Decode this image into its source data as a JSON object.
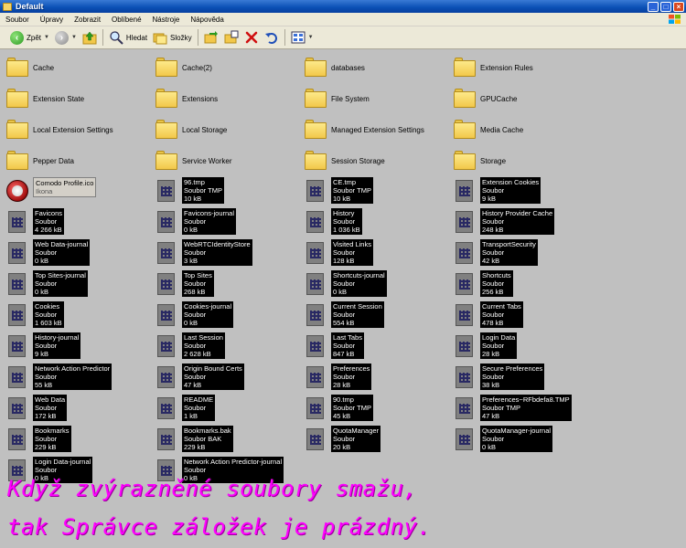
{
  "window": {
    "title": "Default"
  },
  "menu": [
    "Soubor",
    "Úpravy",
    "Zobrazit",
    "Oblíbené",
    "Nástroje",
    "Nápověda"
  ],
  "toolbar": {
    "back_label": "Zpět",
    "search_label": "Hledat",
    "folders_label": "Složky"
  },
  "folders": [
    "Cache",
    "Cache(2)",
    "databases",
    "Extension Rules",
    "Extension State",
    "Extensions",
    "File System",
    "GPUCache",
    "Local Extension Settings",
    "Local Storage",
    "Managed Extension Settings",
    "Media Cache",
    "Pepper Data",
    "Service Worker",
    "Session Storage",
    "Storage"
  ],
  "comodo": {
    "name": "Comodo Profile.ico",
    "type": "Ikona"
  },
  "files": [
    {
      "name": "96.tmp",
      "type": "Soubor TMP",
      "size": "10 kB"
    },
    {
      "name": "CE.tmp",
      "type": "Soubor TMP",
      "size": "10 kB"
    },
    {
      "name": "Extension Cookies",
      "type": "Soubor",
      "size": "9 kB"
    },
    {
      "name": "Favicons",
      "type": "Soubor",
      "size": "4 266 kB"
    },
    {
      "name": "Favicons-journal",
      "type": "Soubor",
      "size": "0 kB"
    },
    {
      "name": "History",
      "type": "Soubor",
      "size": "1 036 kB"
    },
    {
      "name": "History Provider Cache",
      "type": "Soubor",
      "size": "248 kB"
    },
    {
      "name": "Web Data-journal",
      "type": "Soubor",
      "size": "0 kB"
    },
    {
      "name": "WebRTCIdentityStore",
      "type": "Soubor",
      "size": "3 kB"
    },
    {
      "name": "Visited Links",
      "type": "Soubor",
      "size": "128 kB"
    },
    {
      "name": "TransportSecurity",
      "type": "Soubor",
      "size": "42 kB"
    },
    {
      "name": "Top Sites-journal",
      "type": "Soubor",
      "size": "0 kB"
    },
    {
      "name": "Top Sites",
      "type": "Soubor",
      "size": "268 kB"
    },
    {
      "name": "Shortcuts-journal",
      "type": "Soubor",
      "size": "0 kB"
    },
    {
      "name": "Shortcuts",
      "type": "Soubor",
      "size": "256 kB"
    },
    {
      "name": "Cookies",
      "type": "Soubor",
      "size": "1 603 kB"
    },
    {
      "name": "Cookies-journal",
      "type": "Soubor",
      "size": "0 kB"
    },
    {
      "name": "Current Session",
      "type": "Soubor",
      "size": "554 kB"
    },
    {
      "name": "Current Tabs",
      "type": "Soubor",
      "size": "478 kB"
    },
    {
      "name": "History-journal",
      "type": "Soubor",
      "size": "9 kB"
    },
    {
      "name": "Last Session",
      "type": "Soubor",
      "size": "2 628 kB"
    },
    {
      "name": "Last Tabs",
      "type": "Soubor",
      "size": "847 kB"
    },
    {
      "name": "Login Data",
      "type": "Soubor",
      "size": "28 kB"
    },
    {
      "name": "Network Action Predictor",
      "type": "Soubor",
      "size": "55 kB"
    },
    {
      "name": "Origin Bound Certs",
      "type": "Soubor",
      "size": "47 kB"
    },
    {
      "name": "Preferences",
      "type": "Soubor",
      "size": "28 kB"
    },
    {
      "name": "Secure Preferences",
      "type": "Soubor",
      "size": "38 kB"
    },
    {
      "name": "Web Data",
      "type": "Soubor",
      "size": "172 kB"
    },
    {
      "name": "README",
      "type": "Soubor",
      "size": "1 kB"
    },
    {
      "name": "90.tmp",
      "type": "Soubor TMP",
      "size": "45 kB"
    },
    {
      "name": "Preferences~RFbdefa8.TMP",
      "type": "Soubor TMP",
      "size": "47 kB"
    },
    {
      "name": "Bookmarks",
      "type": "Soubor",
      "size": "229 kB"
    },
    {
      "name": "Bookmarks.bak",
      "type": "Soubor BAK",
      "size": "229 kB"
    },
    {
      "name": "QuotaManager",
      "type": "Soubor",
      "size": "20 kB"
    },
    {
      "name": "QuotaManager-journal",
      "type": "Soubor",
      "size": "0 kB"
    },
    {
      "name": "Login Data-journal",
      "type": "Soubor",
      "size": "0 kB"
    },
    {
      "name": "Network Action Predictor-journal",
      "type": "Soubor",
      "size": "0 kB"
    }
  ],
  "caption": {
    "line1": "Když zvýrazněné soubory smažu,",
    "line2": "tak Správce záložek je prázdný."
  }
}
